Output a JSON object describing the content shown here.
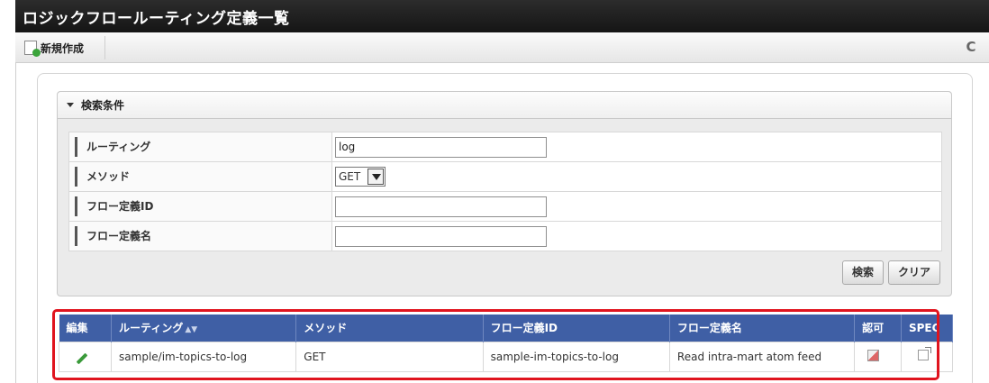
{
  "window": {
    "title": "ロジックフロールーティング定義一覧"
  },
  "toolbar": {
    "new_label": "新規作成"
  },
  "search": {
    "section_label": "検索条件",
    "fields": {
      "routing": {
        "label": "ルーティング",
        "value": "log"
      },
      "method": {
        "label": "メソッド",
        "value": "GET"
      },
      "flow_id": {
        "label": "フロー定義ID",
        "value": ""
      },
      "flow_name": {
        "label": "フロー定義名",
        "value": ""
      }
    },
    "search_button": "検索",
    "clear_button": "クリア"
  },
  "results": {
    "columns": {
      "edit": "編集",
      "routing": "ルーティング",
      "method": "メソッド",
      "flow_id": "フロー定義ID",
      "flow_name": "フロー定義名",
      "permission": "認可",
      "spec": "SPEC"
    },
    "rows": [
      {
        "routing": "sample/im-topics-to-log",
        "method": "GET",
        "flow_id": "sample-im-topics-to-log",
        "flow_name": "Read intra-mart atom feed"
      }
    ]
  },
  "colors": {
    "accent": "#3f5fa5",
    "highlight": "#e0141e",
    "titlebar": "#1f1f1f"
  },
  "icons": [
    "new-document-icon",
    "refresh-icon",
    "collapse-triangle-icon",
    "sort-icon",
    "edit-pencil-icon",
    "permission-icon",
    "external-link-icon"
  ]
}
